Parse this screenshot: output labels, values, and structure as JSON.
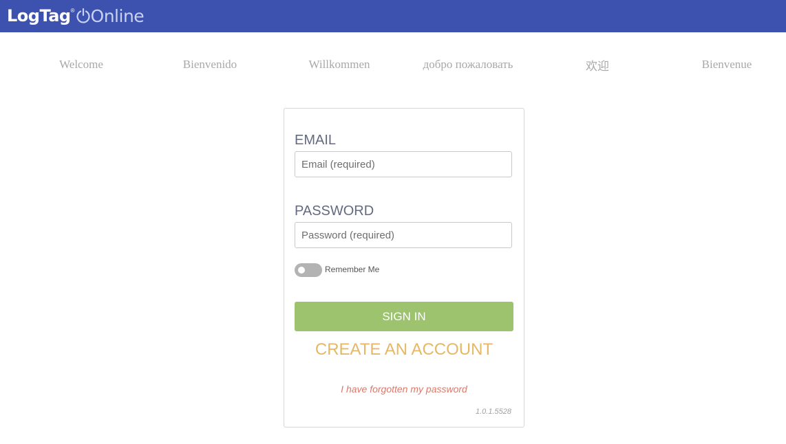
{
  "header": {
    "logo_text_bold": "LogTag",
    "logo_registered": "®",
    "logo_text_light": "Online",
    "logo_icon": "power-icon",
    "background_color": "#3c52ae"
  },
  "welcome": [
    "Welcome",
    "Bienvenido",
    "Willkommen",
    "добро пожаловать",
    "欢迎",
    "Bienvenue"
  ],
  "login": {
    "email_label": "EMAIL",
    "email_placeholder": "Email (required)",
    "email_value": "",
    "password_label": "PASSWORD",
    "password_placeholder": "Password (required)",
    "password_value": "",
    "remember_label": "Remember Me",
    "remember_checked": false,
    "signin_label": "SIGN IN",
    "create_account_label": "CREATE AN ACCOUNT",
    "forgot_label": "I have forgotten my password",
    "version": "1.0.1.5528"
  },
  "colors": {
    "signin_button": "#9dc36f",
    "create_account": "#e5b865",
    "forgot_link": "#d9796b"
  }
}
